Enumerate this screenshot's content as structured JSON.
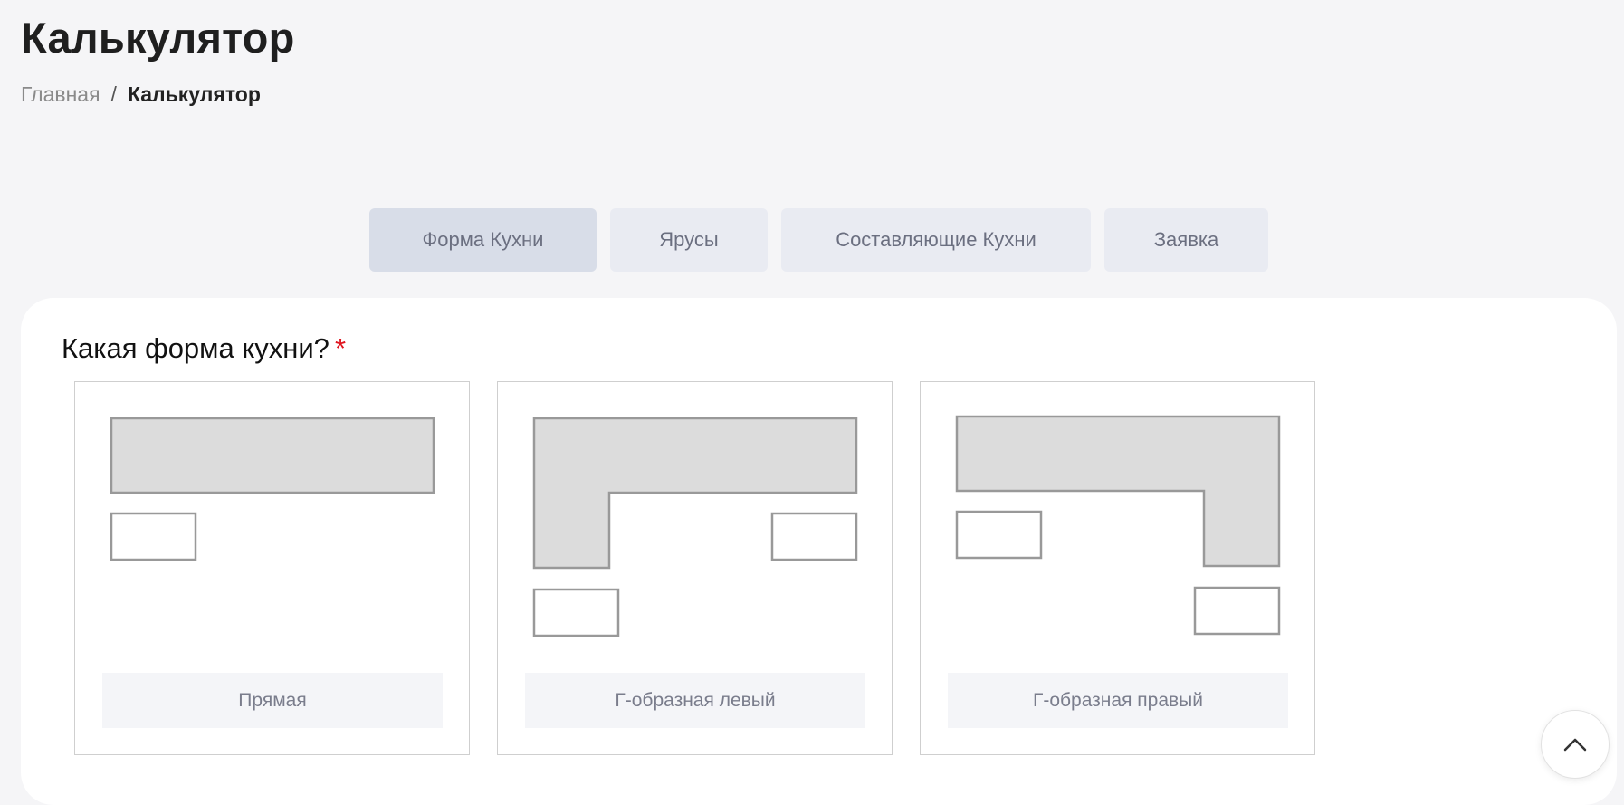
{
  "page": {
    "title": "Калькулятор"
  },
  "breadcrumb": {
    "home": "Главная",
    "separator": "/",
    "current": "Калькулятор"
  },
  "tabs": [
    {
      "label": "Форма Кухни",
      "active": true
    },
    {
      "label": "Ярусы",
      "active": false
    },
    {
      "label": "Составляющие Кухни",
      "active": false
    },
    {
      "label": "Заявка",
      "active": false
    }
  ],
  "question": {
    "text": "Какая форма кухни?",
    "required_mark": "*"
  },
  "options": [
    {
      "label": "Прямая",
      "shape": "straight"
    },
    {
      "label": "Г-образная левый",
      "shape": "l-left"
    },
    {
      "label": "Г-образная правый",
      "shape": "l-right"
    }
  ],
  "colors": {
    "background": "#f5f5f7",
    "tab_active": "#d8dde8",
    "tab_inactive": "#e9ebf2",
    "required": "#e0141e",
    "shape_fill": "#dcdcdc",
    "shape_stroke": "#999999"
  },
  "icons": {
    "scroll_top": "chevron-up-icon"
  }
}
